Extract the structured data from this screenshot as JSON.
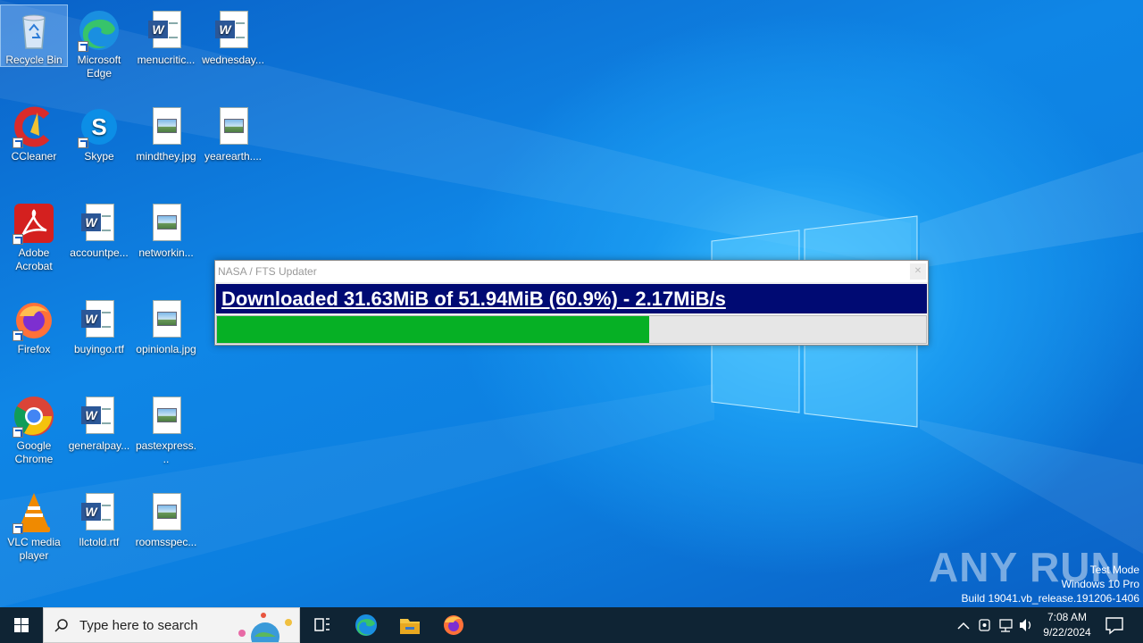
{
  "desktop_icons": [
    {
      "label": "Recycle Bin"
    },
    {
      "label": "Microsoft Edge"
    },
    {
      "label": "menucritic..."
    },
    {
      "label": "wednesday..."
    },
    {
      "label": "CCleaner"
    },
    {
      "label": "Skype"
    },
    {
      "label": "mindthey.jpg"
    },
    {
      "label": "yearearth...."
    },
    {
      "label": "Adobe Acrobat"
    },
    {
      "label": "accountpe..."
    },
    {
      "label": "networkin..."
    },
    {
      "label": "Firefox"
    },
    {
      "label": "buyingo.rtf"
    },
    {
      "label": "opinionla.jpg"
    },
    {
      "label": "Google Chrome"
    },
    {
      "label": "generalpay..."
    },
    {
      "label": "pastexpress..."
    },
    {
      "label": "VLC media player"
    },
    {
      "label": "llctold.rtf"
    },
    {
      "label": "roomsspec..."
    }
  ],
  "updater": {
    "title": "NASA / FTS Updater",
    "status": "Downloaded 31.63MiB of 51.94MiB (60.9%) - 2.17MiB/s",
    "progress_fraction": 0.609,
    "bar_color": "#06b025",
    "banner_color": "#000a73"
  },
  "watermark": {
    "brand": "ANY RUN",
    "line1": "Test Mode",
    "line2": "Windows 10 Pro",
    "line3": "Build 19041.vb_release.191206-1406"
  },
  "taskbar": {
    "search_placeholder": "Type here to search",
    "pinned": [
      "task-view-icon",
      "edge-icon",
      "file-explorer-icon",
      "firefox-icon"
    ],
    "time": "7:08 AM",
    "date": "9/22/2024"
  }
}
